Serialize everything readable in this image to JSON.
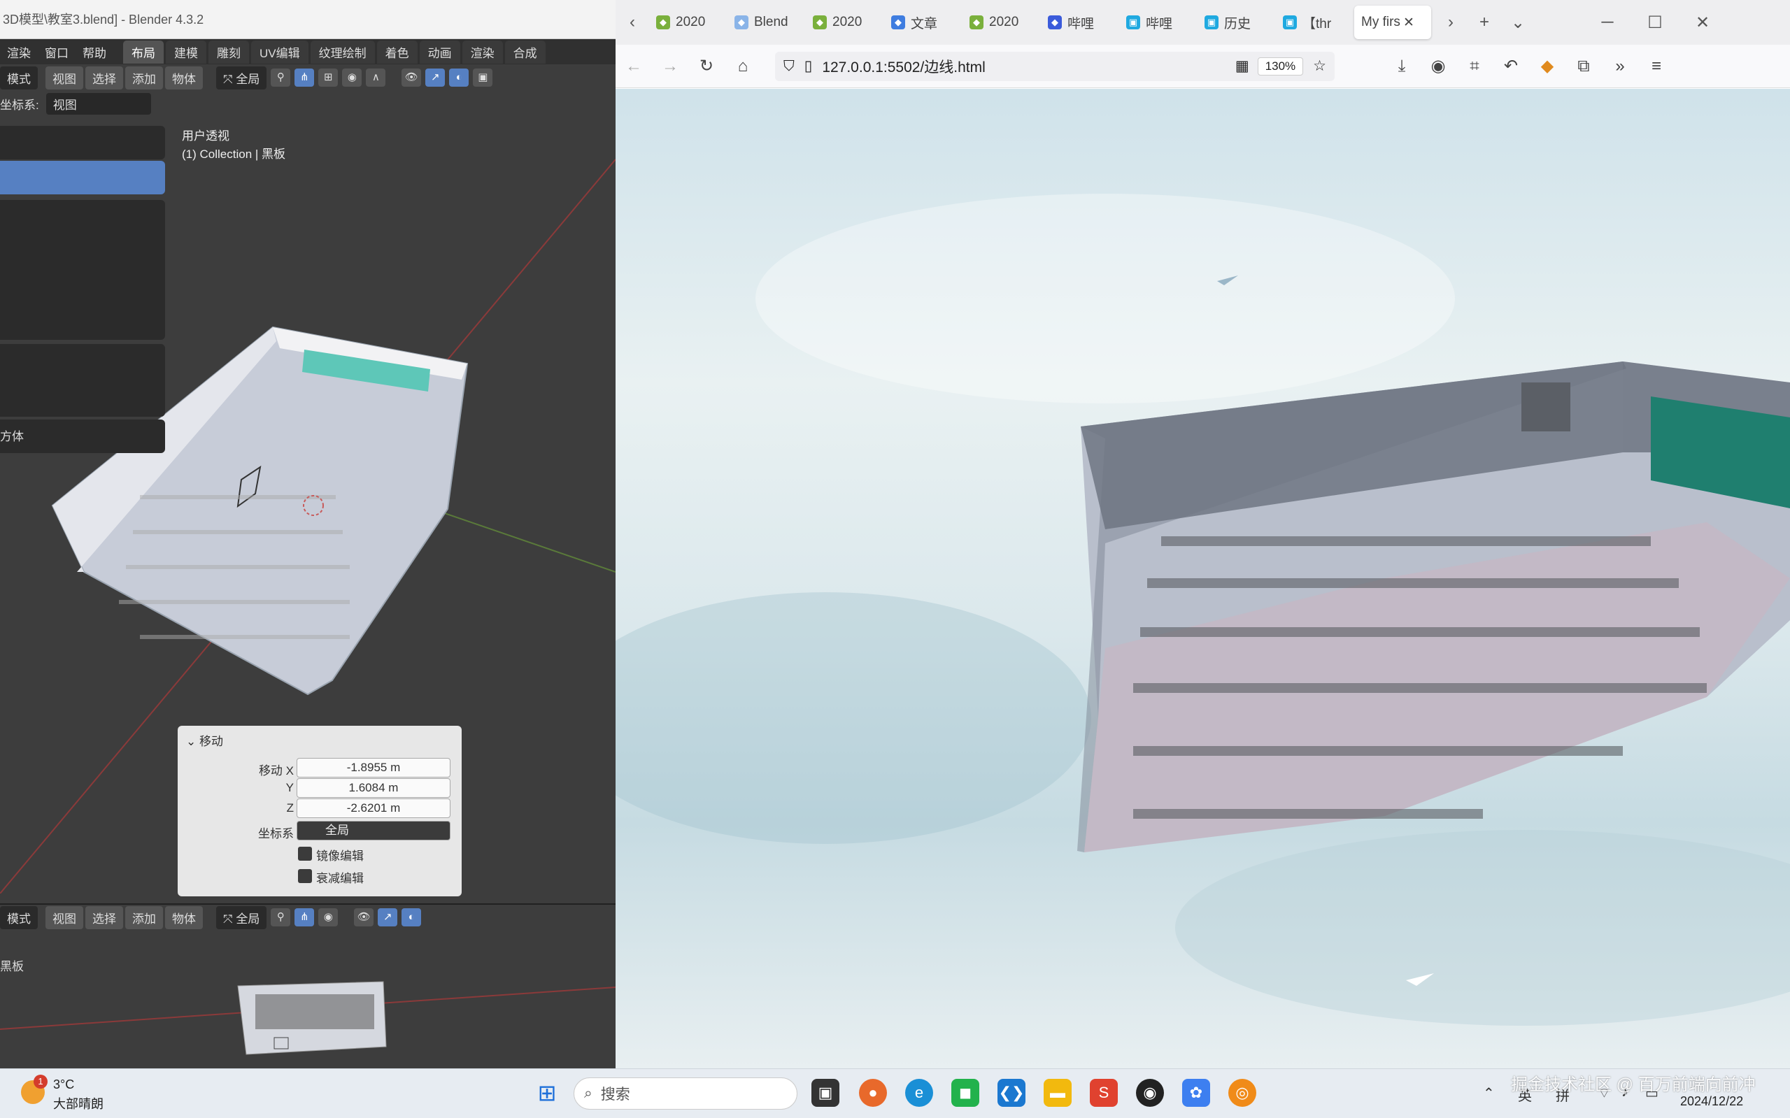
{
  "blender": {
    "title": "3D模型\\教室3.blend] - Blender 4.3.2",
    "menu": [
      "渲染",
      "窗口",
      "帮助"
    ],
    "workspaces": [
      "布局",
      "建模",
      "雕刻",
      "UV编辑",
      "纹理绘制",
      "着色",
      "动画",
      "渲染",
      "合成"
    ],
    "header": {
      "mode": "模式",
      "view": "视图",
      "select": "选择",
      "add": "添加",
      "object": "物体",
      "transform": "全局"
    },
    "coord_label": "坐标系:",
    "coord_value": "视图",
    "panel_item": "方体",
    "viewport_label": "用户透视",
    "collection_label": "(1) Collection | 黑板",
    "operator": {
      "title": "移动",
      "x_label": "移动 X",
      "x_value": "-1.8955 m",
      "y_label": "Y",
      "y_value": "1.6084 m",
      "z_label": "Z",
      "z_value": "-2.6201 m",
      "coord_label": "坐标系",
      "coord_value": "全局",
      "mirror_label": "镜像编辑",
      "proportional_label": "衰减编辑"
    },
    "bottom_object": "黑板"
  },
  "browser": {
    "tabs": [
      {
        "label": "2020",
        "color": "#7ab03c"
      },
      {
        "label": "Blend",
        "color": "#8ab4e8"
      },
      {
        "label": "2020",
        "color": "#7ab03c"
      },
      {
        "label": "文章",
        "color": "#3f7de0"
      },
      {
        "label": "2020",
        "color": "#7ab03c"
      },
      {
        "label": "哔哩",
        "color": "#3b5bdb"
      },
      {
        "label": "哔哩",
        "color": "#1fa9e0"
      },
      {
        "label": "历史",
        "color": "#1fa9e0"
      },
      {
        "label": "【thr",
        "color": "#1fa9e0"
      }
    ],
    "active_tab": "My firs",
    "url": "127.0.0.1:5502/边线.html",
    "zoom": "130%"
  },
  "taskbar": {
    "weather_temp": "3°C",
    "weather_desc": "大部晴朗",
    "weather_badge": "1",
    "search_placeholder": "搜索",
    "tray_lang1": "英",
    "tray_lang2": "拼",
    "date": "2024/12/22",
    "watermark": "掘金技术社区 @ 百万前端向前冲"
  }
}
